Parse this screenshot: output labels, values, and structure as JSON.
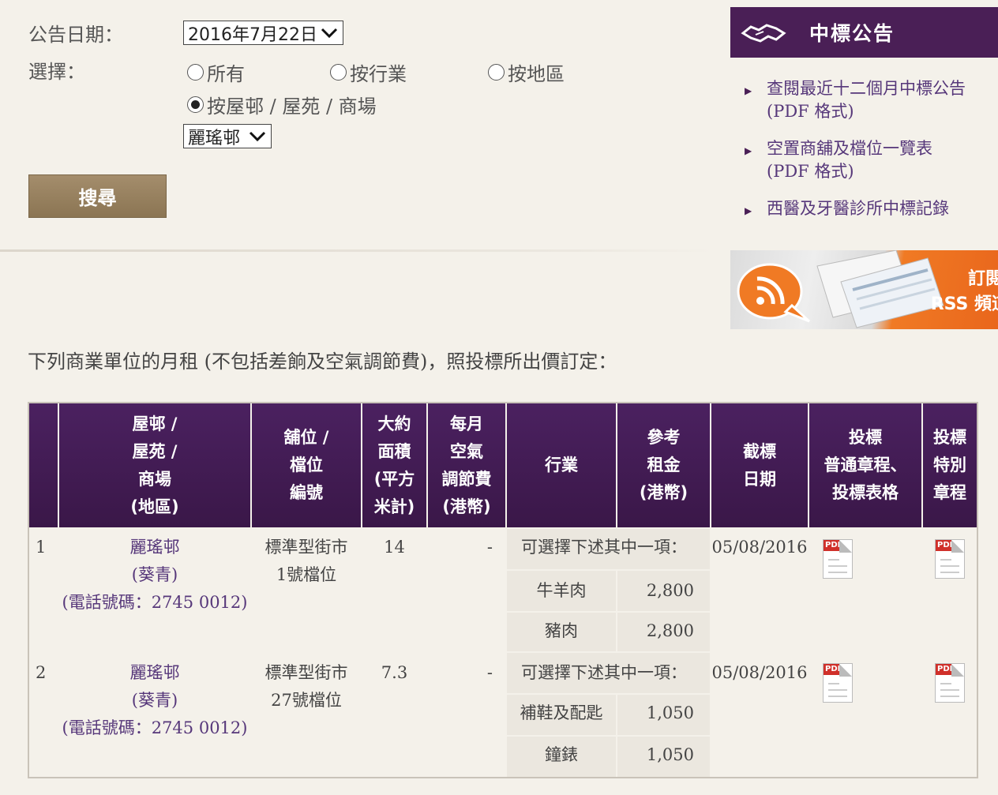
{
  "form": {
    "date_label": "公告日期：",
    "date_value": "2016年7月22日",
    "select_label": "選擇：",
    "radio_all": "所有",
    "radio_trade": "按行業",
    "radio_district": "按地區",
    "radio_estate": "按屋邨 / 屋苑 / 商場",
    "estate_value": "麗瑤邨",
    "search_button": "搜尋"
  },
  "panel": {
    "title": "中標公告",
    "links": [
      {
        "line1": "查閱最近十二個月中標公告",
        "line2": "(PDF 格式)"
      },
      {
        "line1": "空置商舖及檔位一覽表",
        "line2": "(PDF 格式)"
      },
      {
        "line1": "西醫及牙醫診所中標記錄",
        "line2": ""
      }
    ],
    "rss_line1": "訂閱",
    "rss_line2": "RSS 頻道"
  },
  "intro": "下列商業單位的月租 (不包括差餉及空氣調節費)，照投標所出價訂定：",
  "table": {
    "headers": {
      "estate": [
        "屋邨 /",
        "屋苑 /",
        "商場",
        "(地區)"
      ],
      "unit": [
        "舖位 /",
        "檔位",
        "編號"
      ],
      "area": [
        "大約",
        "面積",
        "(平方",
        "米計)"
      ],
      "ac": [
        "每月",
        "空氣",
        "調節費",
        "(港幣)"
      ],
      "trade": [
        "行業"
      ],
      "rent": [
        "參考",
        "租金",
        "(港幣)"
      ],
      "deadline": [
        "截標",
        "日期"
      ],
      "general": [
        "投標",
        "普通章程、",
        "投標表格"
      ],
      "special": [
        "投標",
        "特別",
        "章程"
      ]
    },
    "rows": [
      {
        "no": "1",
        "estate": "麗瑤邨",
        "district": "(葵青)",
        "phone": "(電話號碼：2745 0012)",
        "unit1": "標準型街市",
        "unit2": "1號檔位",
        "area": "14",
        "ac": "-",
        "choose": "可選擇下述其中一項：",
        "trades": [
          {
            "name": "牛羊肉",
            "rent": "2,800"
          },
          {
            "name": "豬肉",
            "rent": "2,800"
          }
        ],
        "deadline": "05/08/2016",
        "pdf": "PDF"
      },
      {
        "no": "2",
        "estate": "麗瑤邨",
        "district": "(葵青)",
        "phone": "(電話號碼：2745 0012)",
        "unit1": "標準型街市",
        "unit2": "27號檔位",
        "area": "7.3",
        "ac": "-",
        "choose": "可選擇下述其中一項：",
        "trades": [
          {
            "name": "補鞋及配匙",
            "rent": "1,050"
          },
          {
            "name": "鐘錶",
            "rent": "1,050"
          }
        ],
        "deadline": "05/08/2016",
        "pdf": "PDF"
      }
    ]
  },
  "colors": {
    "header_purple": "#4a1f56",
    "link_purple": "#56377a",
    "button_tan": "#9a8461",
    "rss_orange": "#f07a24"
  }
}
